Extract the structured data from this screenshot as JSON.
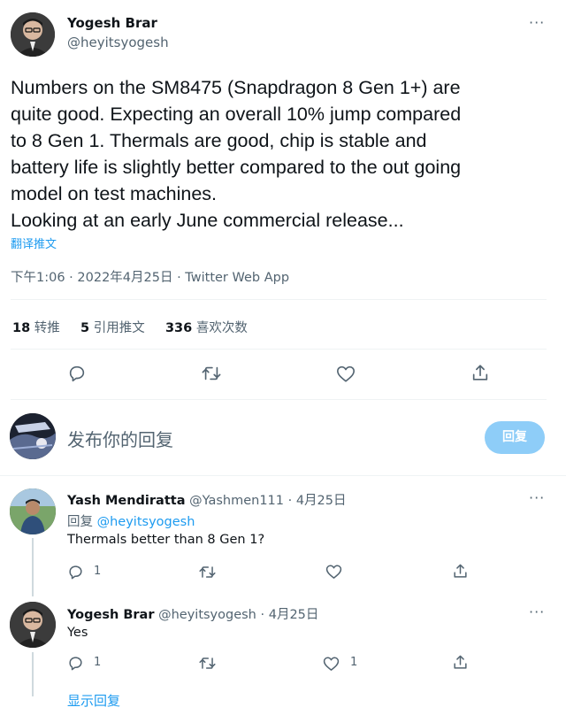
{
  "tweet": {
    "author_name": "Yogesh Brar",
    "author_handle": "@heyitsyogesh",
    "text_lines": [
      "Numbers on the SM8475 (Snapdragon 8 Gen 1+) are",
      "quite good. Expecting an overall 10% jump compared",
      "to 8 Gen 1. Thermals are good, chip is stable and",
      "battery life is slightly better compared to the out going",
      "model on test machines.",
      "Looking at an early June commercial release..."
    ],
    "translate_label": "翻译推文",
    "timestamp": "下午1:06 · 2022年4月25日 · Twitter Web App",
    "more": "···",
    "stats": {
      "retweets_count": "18",
      "retweets_label": "转推",
      "quotes_count": "5",
      "quotes_label": "引用推文",
      "likes_count": "336",
      "likes_label": "喜欢次数"
    }
  },
  "compose": {
    "placeholder": "发布你的回复",
    "reply_button": "回复"
  },
  "replies": [
    {
      "name": "Yash Mendiratta",
      "handle": "@Yashmen111",
      "date": "· 4月25日",
      "reply_to_prefix": "回复",
      "reply_to_handle": "@heyitsyogesh",
      "text": "Thermals better than 8 Gen 1?",
      "reply_count": "1",
      "like_count": "",
      "more": "···"
    },
    {
      "name": "Yogesh Brar",
      "handle": "@heyitsyogesh",
      "date": "· 4月25日",
      "text": "Yes",
      "reply_count": "1",
      "like_count": "1",
      "more": "···"
    }
  ],
  "show_replies": "显示回复",
  "colors": {
    "accent": "#1d9bf0",
    "muted": "#536471",
    "reply_button": "#8ecdf8"
  },
  "icons": [
    "more-icon",
    "reply-icon",
    "retweet-icon",
    "like-icon",
    "share-icon"
  ]
}
